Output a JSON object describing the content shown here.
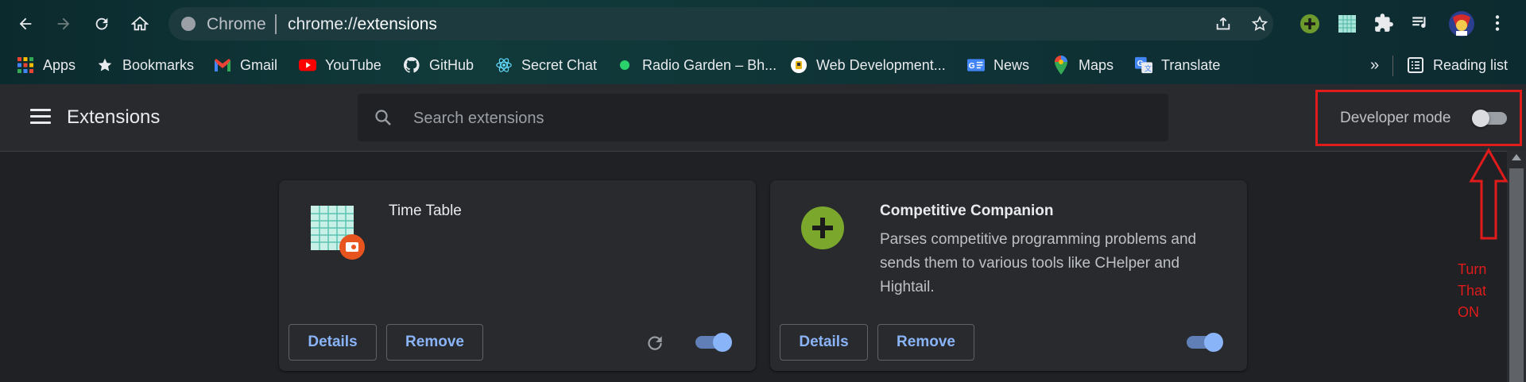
{
  "browser": {
    "omnibox": {
      "scheme_label": "Chrome",
      "url_scheme": "chrome://",
      "url_host": "extensions"
    },
    "icons": [
      "back-icon",
      "forward-icon",
      "reload-icon",
      "home-icon",
      "share-icon",
      "star-icon",
      "extensions-puzzle-icon",
      "media-controls-icon",
      "more-menu-icon"
    ]
  },
  "bookmarks": [
    {
      "label": "Apps",
      "icon": "apps-grid-icon"
    },
    {
      "label": "Bookmarks",
      "icon": "star-icon"
    },
    {
      "label": "Gmail",
      "icon": "gmail-icon"
    },
    {
      "label": "YouTube",
      "icon": "youtube-icon"
    },
    {
      "label": "GitHub",
      "icon": "github-icon"
    },
    {
      "label": "Secret Chat",
      "icon": "react-icon"
    },
    {
      "label": "Radio Garden – Bh...",
      "icon": "green-dot-icon"
    },
    {
      "label": "Web Development...",
      "icon": "web-dev-icon"
    },
    {
      "label": "News",
      "icon": "google-news-icon"
    },
    {
      "label": "Maps",
      "icon": "google-maps-icon"
    },
    {
      "label": "Translate",
      "icon": "google-translate-icon"
    }
  ],
  "bookmarks_overflow": "»",
  "reading_list": "Reading list",
  "extensions_page": {
    "title": "Extensions",
    "search_placeholder": "Search extensions",
    "developer_mode_label": "Developer mode",
    "developer_mode_on": false
  },
  "cards": [
    {
      "name": "Time Table",
      "description": "",
      "details_label": "Details",
      "remove_label": "Remove",
      "enabled": true,
      "has_reload": true
    },
    {
      "name": "Competitive Companion",
      "description": "Parses competitive programming problems and sends them to various tools like CHelper and Hightail.",
      "details_label": "Details",
      "remove_label": "Remove",
      "enabled": true,
      "has_reload": false
    }
  ],
  "annotation": {
    "line1": "Turn",
    "line2": "That",
    "line3": "ON",
    "color": "#e01b1b"
  },
  "colors": {
    "accent": "#8ab4f8",
    "background": "#202124",
    "card": "#292a2d",
    "annotation_red": "#e01b1b"
  }
}
